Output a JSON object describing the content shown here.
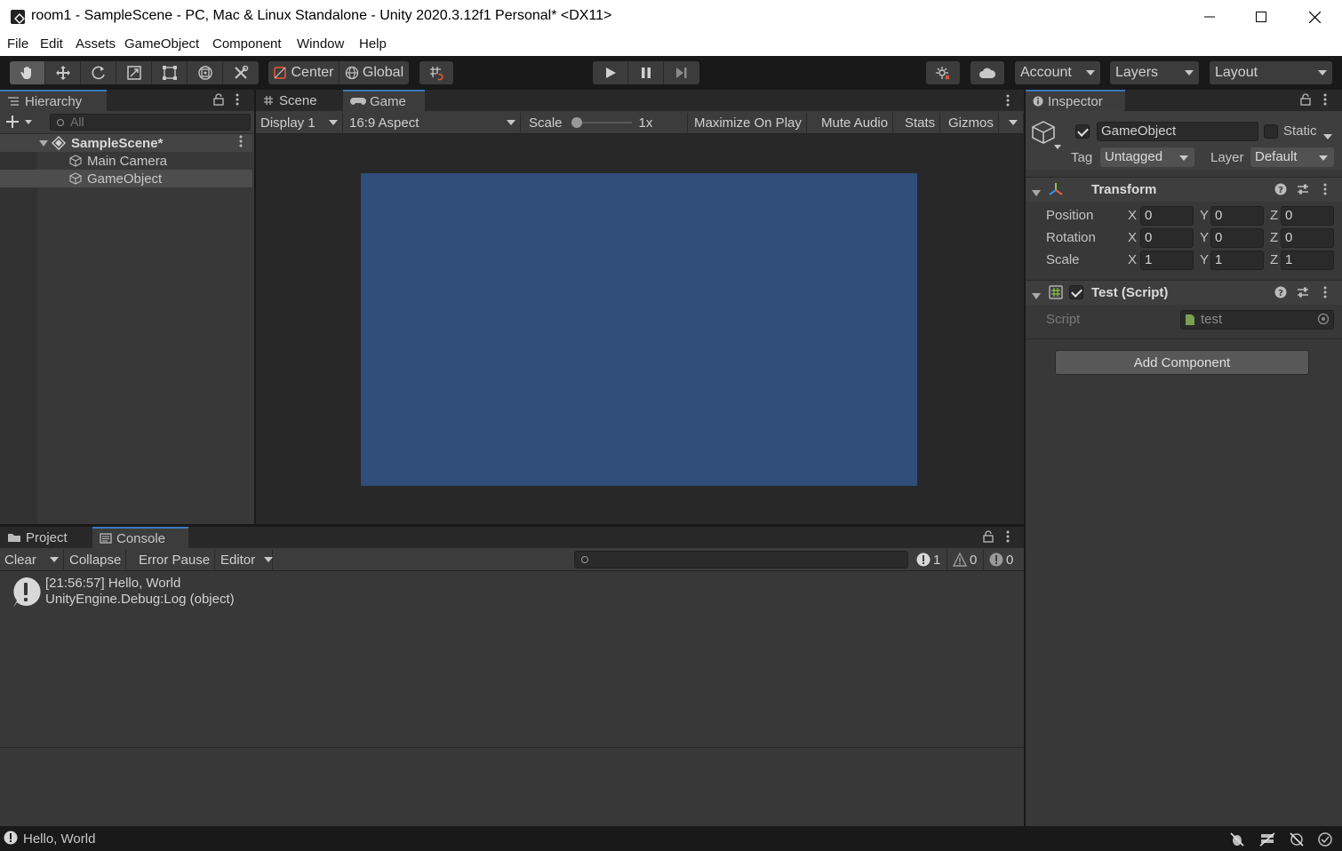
{
  "window": {
    "title": "room1 - SampleScene - PC, Mac & Linux Standalone - Unity 2020.3.12f1 Personal* <DX11>"
  },
  "menu": [
    "File",
    "Edit",
    "Assets",
    "GameObject",
    "Component",
    "Window",
    "Help"
  ],
  "toolbar": {
    "pivot_label": "Center",
    "space_label": "Global",
    "account_label": "Account",
    "layers_label": "Layers",
    "layout_label": "Layout"
  },
  "hierarchy": {
    "tab_label": "Hierarchy",
    "search_placeholder": "All",
    "scene_name": "SampleScene*",
    "items": [
      "Main Camera",
      "GameObject"
    ]
  },
  "game_view": {
    "tabs": [
      "Scene",
      "Game"
    ],
    "display": "Display 1",
    "aspect": "16:9 Aspect",
    "scale_label": "Scale",
    "scale_value": "1x",
    "buttons": [
      "Maximize On Play",
      "Mute Audio",
      "Stats",
      "Gizmos"
    ],
    "background_color": "#314d79"
  },
  "inspector": {
    "tab_label": "Inspector",
    "object_name": "GameObject",
    "static_label": "Static",
    "tag_label": "Tag",
    "tag_value": "Untagged",
    "layer_label": "Layer",
    "layer_value": "Default",
    "transform": {
      "title": "Transform",
      "rows": [
        {
          "label": "Position",
          "x": "0",
          "y": "0",
          "z": "0"
        },
        {
          "label": "Rotation",
          "x": "0",
          "y": "0",
          "z": "0"
        },
        {
          "label": "Scale",
          "x": "1",
          "y": "1",
          "z": "1"
        }
      ]
    },
    "script_component": {
      "title": "Test (Script)",
      "script_label": "Script",
      "script_value": "test"
    },
    "add_component_label": "Add Component"
  },
  "console": {
    "tabs": [
      "Project",
      "Console"
    ],
    "clear_label": "Clear",
    "collapse_label": "Collapse",
    "error_pause_label": "Error Pause",
    "editor_label": "Editor",
    "log_count": "1",
    "warning_count": "0",
    "error_count": "0",
    "entries": [
      {
        "line1": "[21:56:57] Hello, World",
        "line2": "UnityEngine.Debug:Log (object)"
      }
    ]
  },
  "status": {
    "message": "Hello, World"
  },
  "axis_labels": {
    "x": "X",
    "y": "Y",
    "z": "Z"
  }
}
